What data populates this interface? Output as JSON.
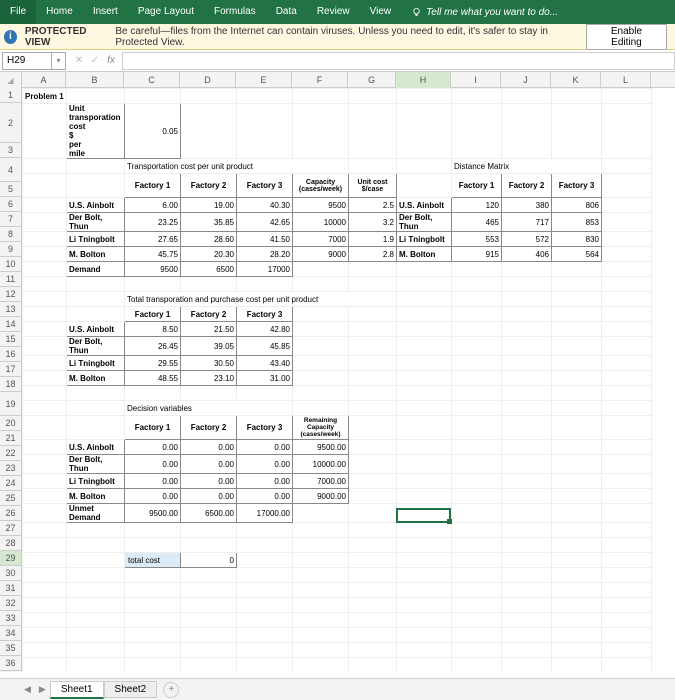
{
  "ribbon": {
    "tabs": [
      "File",
      "Home",
      "Insert",
      "Page Layout",
      "Formulas",
      "Data",
      "Review",
      "View"
    ],
    "tellme": "Tell me what you want to do..."
  },
  "pv": {
    "title": "PROTECTED VIEW",
    "text": "Be careful—files from the Internet can contain viruses. Unless you need to edit, it's safer to stay in Protected View.",
    "btn": "Enable Editing"
  },
  "fx": {
    "name": "H29"
  },
  "cols": [
    "A",
    "B",
    "C",
    "D",
    "E",
    "F",
    "G",
    "H",
    "I",
    "J",
    "K",
    "L"
  ],
  "a1": "Problem 1",
  "b2a": "Unit transporation cost $ per mile",
  "c2": "0.05",
  "t1": {
    "title": "Transportation cost per unit product",
    "hdrs": [
      "Factory 1",
      "Factory 2",
      "Factory 3",
      "Capacity (cases/week)",
      "Unit cost $/case"
    ],
    "rows": [
      "U.S. Ainbolt",
      "Der Bolt, Thun",
      "Li Tningbolt",
      "M. Bolton",
      "Demand"
    ],
    "data": [
      [
        "6.00",
        "19.00",
        "40.30",
        "9500",
        "2.5"
      ],
      [
        "23.25",
        "35.85",
        "42.65",
        "10000",
        "3.2"
      ],
      [
        "27.65",
        "28.60",
        "41.50",
        "7000",
        "1.9"
      ],
      [
        "45.75",
        "20.30",
        "28.20",
        "9000",
        "2.8"
      ],
      [
        "9500",
        "6500",
        "17000",
        "",
        ""
      ]
    ]
  },
  "t2": {
    "title": "Distance Matrix",
    "hdrs": [
      "Factory 1",
      "Factory 2",
      "Factory 3"
    ],
    "rows": [
      "U.S. Ainbolt",
      "Der Bolt, Thun",
      "Li Tningbolt",
      "M. Bolton"
    ],
    "data": [
      [
        "120",
        "380",
        "806"
      ],
      [
        "465",
        "717",
        "853"
      ],
      [
        "553",
        "572",
        "830"
      ],
      [
        "915",
        "406",
        "564"
      ]
    ]
  },
  "t3": {
    "title": "Total transporation and purchase cost per unit product",
    "hdrs": [
      "Factory 1",
      "Factory 2",
      "Factory 3"
    ],
    "rows": [
      "U.S. Ainbolt",
      "Der Bolt, Thun",
      "Li Tningbolt",
      "M. Bolton"
    ],
    "data": [
      [
        "8.50",
        "21.50",
        "42.80"
      ],
      [
        "26.45",
        "39.05",
        "45.85"
      ],
      [
        "29.55",
        "30.50",
        "43.40"
      ],
      [
        "48.55",
        "23.10",
        "31.00"
      ]
    ]
  },
  "t4": {
    "title": "Decision variables",
    "hdrs": [
      "Factory 1",
      "Factory 2",
      "Factory 3",
      "Remaining Capacity (cases/week)"
    ],
    "rows": [
      "U.S. Ainbolt",
      "Der Bolt, Thun",
      "Li Tningbolt",
      "M. Bolton",
      "Unmet Demand"
    ],
    "data": [
      [
        "0.00",
        "0.00",
        "0.00",
        "9500.00"
      ],
      [
        "0.00",
        "0.00",
        "0.00",
        "10000.00"
      ],
      [
        "0.00",
        "0.00",
        "0.00",
        "7000.00"
      ],
      [
        "0.00",
        "0.00",
        "0.00",
        "9000.00"
      ],
      [
        "9500.00",
        "6500.00",
        "17000.00",
        ""
      ]
    ]
  },
  "totalcost": {
    "label": "total cost",
    "value": "0"
  },
  "tabs": {
    "s1": "Sheet1",
    "s2": "Sheet2"
  }
}
